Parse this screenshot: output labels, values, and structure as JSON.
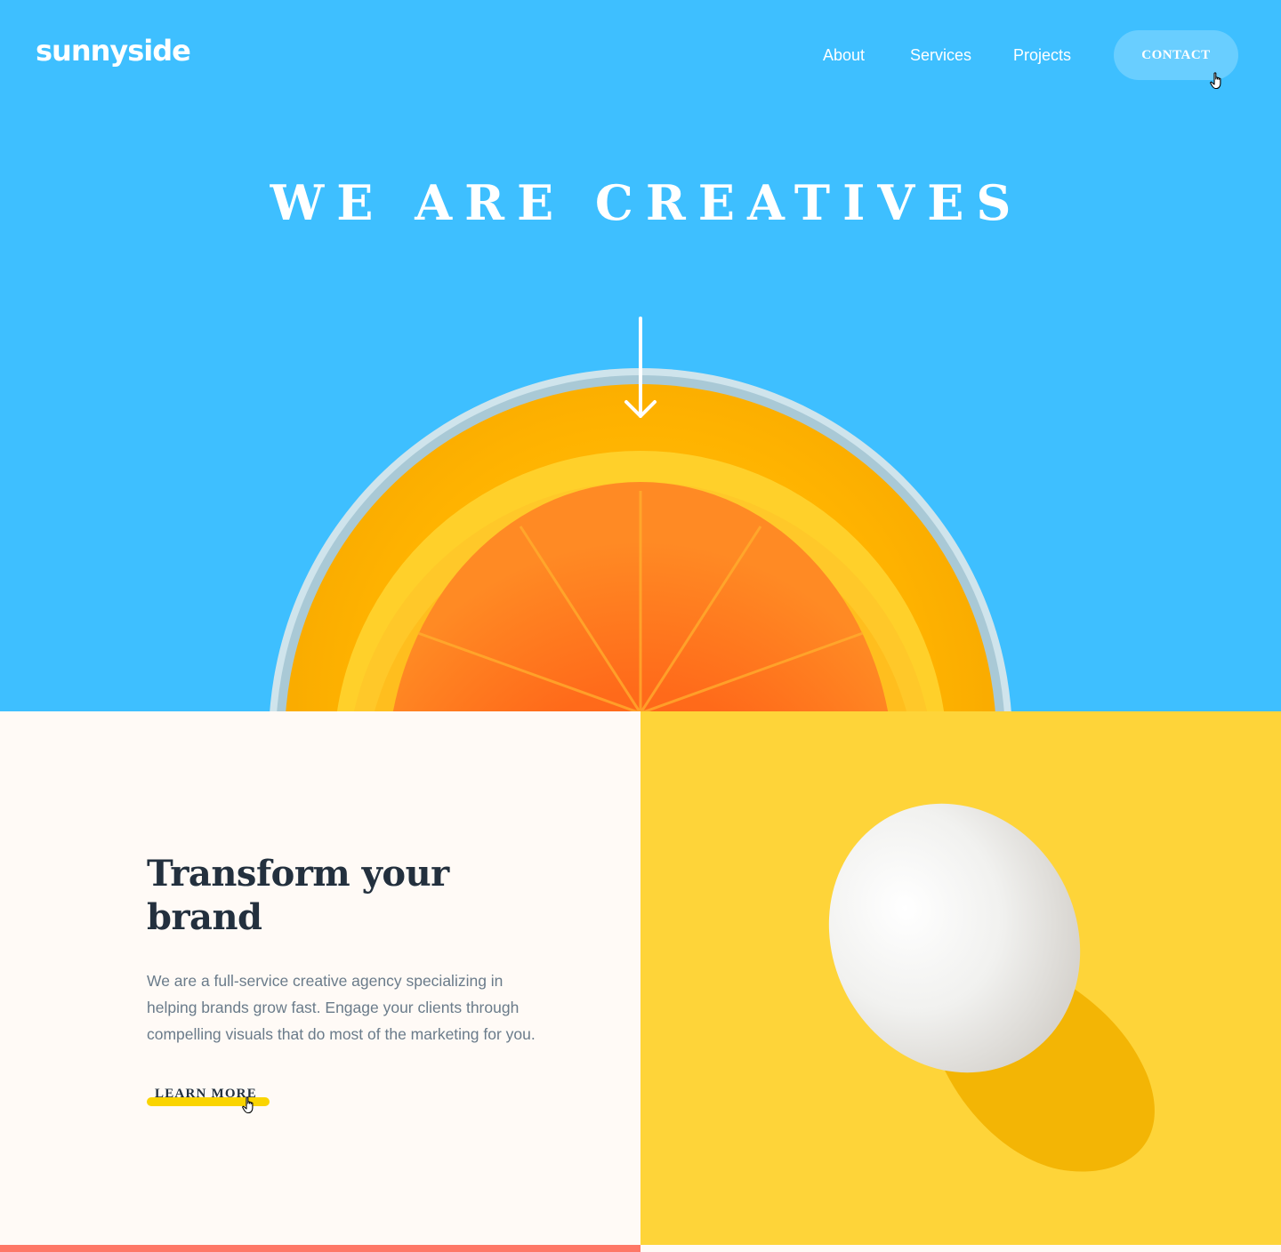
{
  "header": {
    "logo": "sunnyside",
    "nav": [
      {
        "label": "About"
      },
      {
        "label": "Services"
      },
      {
        "label": "Projects"
      }
    ],
    "contact_label": "CONTACT"
  },
  "hero": {
    "title": "WE ARE CREATIVES",
    "arrow_icon": "arrow-down-icon"
  },
  "feature": {
    "title": "Transform your brand",
    "body": "We are a full-service creative agency specializing in helping brands grow fast. Engage your clients through compelling visuals that do most of the marketing for you.",
    "cta_label": "LEARN MORE"
  },
  "colors": {
    "hero_bg": "#3ebfff",
    "contact_bg": "#69ceff",
    "panel_bg": "#fffaf6",
    "egg_bg": "#fed439",
    "heading": "#23303e",
    "body_text": "#6a7b8a",
    "underline": "#fad400",
    "footer_strip": "#fe7766"
  }
}
